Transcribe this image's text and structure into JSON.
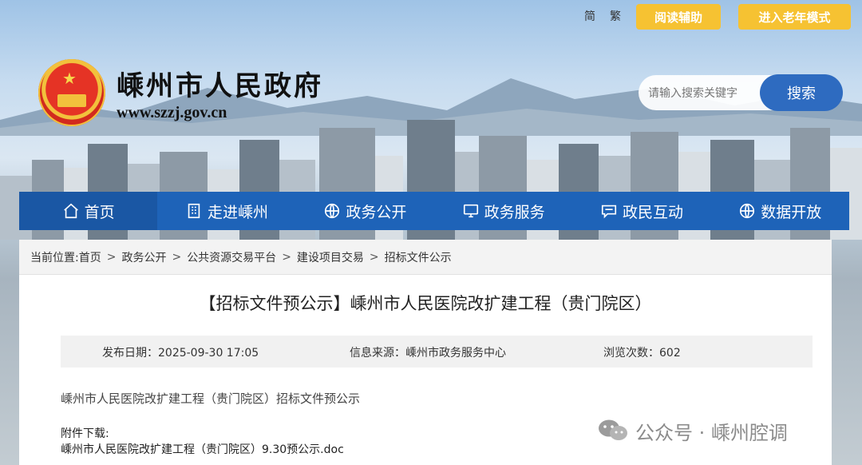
{
  "header": {
    "site_name": "嵊州市人民政府",
    "site_url": "www.szzj.gov.cn",
    "lang_simplified": "简",
    "lang_traditional": "繁",
    "reading_aid_label": "阅读辅助",
    "elder_mode_label": "进入老年模式",
    "search_placeholder": "请输入搜索关键字",
    "search_button_label": "搜索"
  },
  "nav": {
    "items": [
      {
        "label": "首页",
        "icon": "home-icon"
      },
      {
        "label": "走进嵊州",
        "icon": "building-icon"
      },
      {
        "label": "政务公开",
        "icon": "globe-icon"
      },
      {
        "label": "政务服务",
        "icon": "monitor-icon"
      },
      {
        "label": "政民互动",
        "icon": "chat-icon"
      },
      {
        "label": "数据开放",
        "icon": "globe-icon"
      }
    ]
  },
  "breadcrumb": {
    "prefix": "当前位置:",
    "items": [
      "首页",
      "政务公开",
      "公共资源交易平台",
      "建设项目交易",
      "招标文件公示"
    ],
    "separator": ">"
  },
  "article": {
    "title": "【招标文件预公示】嵊州市人民医院改扩建工程（贵门院区）",
    "publish_date": "发布日期：2025-09-30 17:05",
    "source": "信息来源：嵊州市政务服务中心",
    "views": "浏览次数：602",
    "body": "嵊州市人民医院改扩建工程（贵门院区）招标文件预公示",
    "attachment_label": "附件下载:",
    "attachment_file": "嵊州市人民医院改扩建工程（贵门院区）9.30预公示.doc"
  },
  "watermark": {
    "text": "公众号 · 嵊州腔调",
    "icon": "wechat-icon"
  },
  "colors": {
    "nav_blue": "#1e63b8",
    "accent_yellow": "#f6c232",
    "search_blue": "#2e6bc0"
  }
}
